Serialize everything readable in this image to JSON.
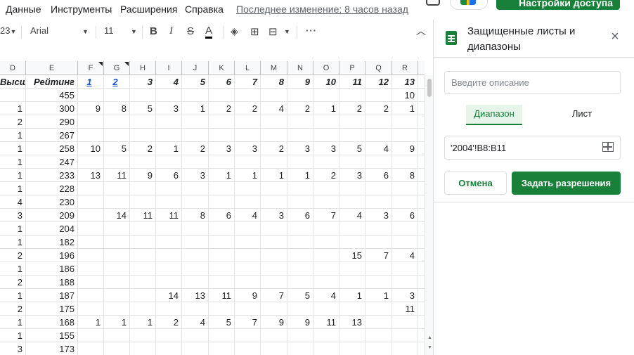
{
  "menu": {
    "items": [
      "Данные",
      "Инструменты",
      "Расширения",
      "Справка"
    ],
    "last_edit": "Последнее изменение: 8 часов назад",
    "share_label": "Настройки доступа"
  },
  "toolbar": {
    "zoom_fragment": "23",
    "font": "Arial",
    "font_size": "11"
  },
  "columns": [
    "D",
    "E",
    "F",
    "G",
    "H",
    "I",
    "J",
    "K",
    "L",
    "M",
    "N",
    "O",
    "P",
    "Q",
    "R"
  ],
  "header_row": [
    "Высшее",
    "Рейтинг",
    "1",
    "2",
    "3",
    "4",
    "5",
    "6",
    "7",
    "8",
    "9",
    "10",
    "11",
    "12",
    "13"
  ],
  "rows": [
    [
      "",
      "455",
      "",
      "",
      "",
      "",
      "",
      "",
      "",
      "",
      "",
      "",
      "",
      "",
      "10"
    ],
    [
      "1",
      "300",
      "9",
      "8",
      "5",
      "3",
      "1",
      "2",
      "2",
      "4",
      "2",
      "1",
      "2",
      "2",
      "1"
    ],
    [
      "2",
      "290",
      "",
      "",
      "",
      "",
      "",
      "",
      "",
      "",
      "",
      "",
      "",
      "",
      ""
    ],
    [
      "1",
      "267",
      "",
      "",
      "",
      "",
      "",
      "",
      "",
      "",
      "",
      "",
      "",
      "",
      ""
    ],
    [
      "1",
      "258",
      "10",
      "5",
      "2",
      "1",
      "2",
      "3",
      "3",
      "2",
      "3",
      "3",
      "5",
      "4",
      "9"
    ],
    [
      "1",
      "247",
      "",
      "",
      "",
      "",
      "",
      "",
      "",
      "",
      "",
      "",
      "",
      "",
      ""
    ],
    [
      "1",
      "233",
      "13",
      "11",
      "9",
      "6",
      "3",
      "1",
      "1",
      "1",
      "1",
      "2",
      "3",
      "6",
      "8"
    ],
    [
      "1",
      "228",
      "",
      "",
      "",
      "",
      "",
      "",
      "",
      "",
      "",
      "",
      "",
      "",
      ""
    ],
    [
      "4",
      "230",
      "",
      "",
      "",
      "",
      "",
      "",
      "",
      "",
      "",
      "",
      "",
      "",
      ""
    ],
    [
      "3",
      "209",
      "",
      "14",
      "11",
      "11",
      "8",
      "6",
      "4",
      "3",
      "6",
      "7",
      "4",
      "3",
      "6"
    ],
    [
      "1",
      "204",
      "",
      "",
      "",
      "",
      "",
      "",
      "",
      "",
      "",
      "",
      "",
      "",
      ""
    ],
    [
      "1",
      "182",
      "",
      "",
      "",
      "",
      "",
      "",
      "",
      "",
      "",
      "",
      "",
      "",
      ""
    ],
    [
      "2",
      "196",
      "",
      "",
      "",
      "",
      "",
      "",
      "",
      "",
      "",
      "",
      "15",
      "7",
      "4"
    ],
    [
      "1",
      "186",
      "",
      "",
      "",
      "",
      "",
      "",
      "",
      "",
      "",
      "",
      "",
      "",
      ""
    ],
    [
      "2",
      "188",
      "",
      "",
      "",
      "",
      "",
      "",
      "",
      "",
      "",
      "",
      "",
      "",
      ""
    ],
    [
      "1",
      "187",
      "",
      "",
      "",
      "14",
      "13",
      "11",
      "9",
      "7",
      "5",
      "4",
      "1",
      "1",
      "3"
    ],
    [
      "2",
      "175",
      "",
      "",
      "",
      "",
      "",
      "",
      "",
      "",
      "",
      "",
      "",
      "",
      "11"
    ],
    [
      "1",
      "168",
      "1",
      "1",
      "1",
      "2",
      "4",
      "5",
      "7",
      "9",
      "9",
      "11",
      "13",
      "",
      ""
    ],
    [
      "1",
      "155",
      "",
      "",
      "",
      "",
      "",
      "",
      "",
      "",
      "",
      "",
      "",
      "",
      ""
    ],
    [
      "3",
      "173",
      "",
      "",
      "",
      "",
      "",
      "",
      "",
      "",
      "",
      "",
      "",
      "",
      ""
    ]
  ],
  "panel": {
    "title": "Защищенные листы и диапазоны",
    "description_placeholder": "Введите описание",
    "tab_range": "Диапазон",
    "tab_sheet": "Лист",
    "range_value": "'2004'!B8:B11",
    "cancel": "Отмена",
    "set_permissions": "Задать разрешения"
  },
  "colors": {
    "accent_green": "#188038",
    "link_blue": "#1155cc"
  }
}
